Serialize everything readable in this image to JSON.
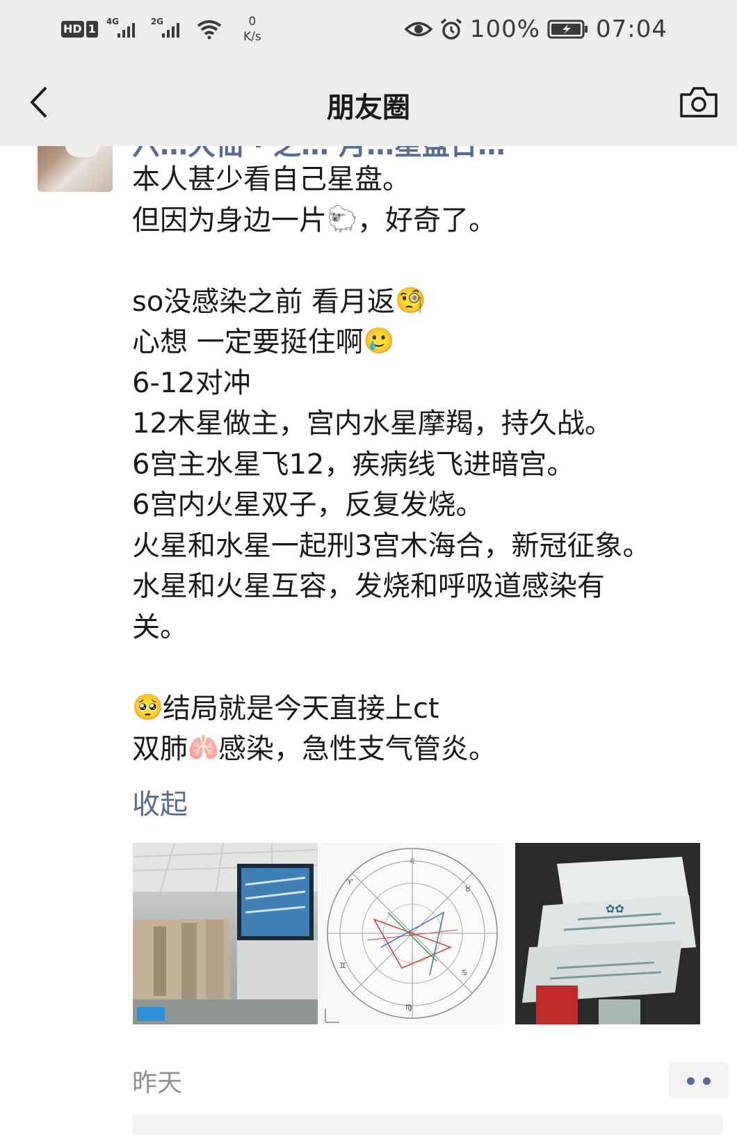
{
  "status_bar": {
    "hd_label": "HD",
    "sim_label": "1",
    "signal1_tag": "4G",
    "signal2_tag": "2G",
    "net_speed_value": "0",
    "net_speed_unit": "K/s",
    "battery_percent": "100%",
    "clock": "07:04",
    "icons": [
      "eye-icon",
      "alarm-icon",
      "battery-icon",
      "wifi-icon"
    ]
  },
  "header": {
    "title": "朋友圈",
    "back_icon": "chevron-left-icon",
    "camera_icon": "camera-icon"
  },
  "post": {
    "author_partial": "六…大仙 · 之… 月…星盘日…",
    "lines": [
      {
        "text": "本人甚少看自己星盘。"
      },
      {
        "text": "但因为身边一片",
        "emoji": "🐑",
        "after": "，好奇了。"
      },
      {
        "text": ""
      },
      {
        "text": "so没感染之前 看月返",
        "emoji": "🧐"
      },
      {
        "text": "心想 一定要挺住啊",
        "emoji": "🥲"
      },
      {
        "text": "6-12对冲"
      },
      {
        "text": "12木星做主，宫内水星摩羯，持久战。"
      },
      {
        "text": "6宫主水星飞12，疾病线飞进暗宫。"
      },
      {
        "text": "6宫内火星双子，反复发烧。"
      },
      {
        "text": "火星和水星一起刑3宫木海合，新冠征象。"
      },
      {
        "text": "水星和火星互容，发烧和呼吸道感染有"
      },
      {
        "text": "关。"
      },
      {
        "text": ""
      },
      {
        "emoji_first": "🥺",
        "text": "结局就是今天直接上ct"
      },
      {
        "text": "双肺",
        "emoji": "🫁",
        "after": "感染，急性支气管炎。"
      }
    ],
    "collapse_label": "收起",
    "images": [
      "hospital-corridor-photo",
      "astrology-chart-photo",
      "medicine-packets-photo"
    ],
    "time": "昨天",
    "more_button": "more-icon"
  },
  "colors": {
    "topbar_bg": "#ededed",
    "link_blue": "#576b95",
    "text_dark": "#1a1a1a",
    "time_gray": "#8f8f8f"
  }
}
